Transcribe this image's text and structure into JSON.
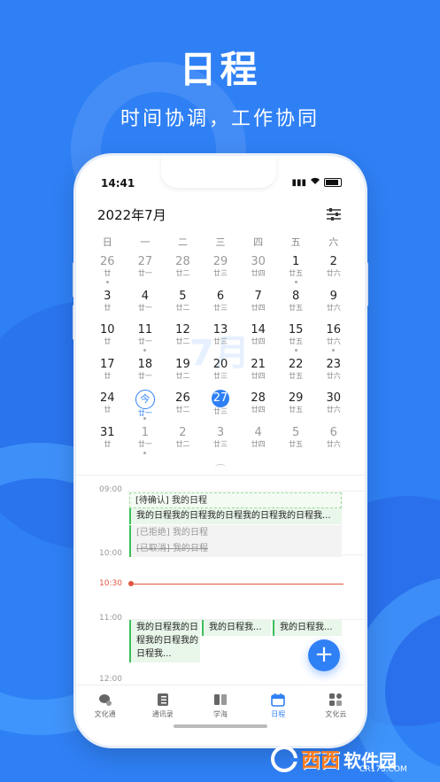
{
  "hero": {
    "title": "日程",
    "subtitle": "时间协调，工作协同"
  },
  "status": {
    "time": "14:41"
  },
  "calendar": {
    "month_title": "2022年7月",
    "watermark": "7月",
    "weekdays": [
      "日",
      "一",
      "二",
      "三",
      "四",
      "五",
      "六"
    ],
    "weeks": [
      [
        {
          "n": "26",
          "l": "廿",
          "o": true,
          "d": true
        },
        {
          "n": "27",
          "l": "廿一",
          "o": true
        },
        {
          "n": "28",
          "l": "廿二",
          "o": true
        },
        {
          "n": "29",
          "l": "廿三",
          "o": true
        },
        {
          "n": "30",
          "l": "廿四",
          "o": true
        },
        {
          "n": "1",
          "l": "廿五",
          "d": true
        },
        {
          "n": "2",
          "l": "廿六"
        }
      ],
      [
        {
          "n": "3",
          "l": "廿"
        },
        {
          "n": "4",
          "l": "廿一"
        },
        {
          "n": "5",
          "l": "廿二"
        },
        {
          "n": "6",
          "l": "廿三"
        },
        {
          "n": "7",
          "l": "廿四"
        },
        {
          "n": "8",
          "l": "廿五"
        },
        {
          "n": "9",
          "l": "廿六"
        }
      ],
      [
        {
          "n": "10",
          "l": "廿"
        },
        {
          "n": "11",
          "l": "廿一",
          "d": true
        },
        {
          "n": "12",
          "l": "廿二"
        },
        {
          "n": "13",
          "l": "廿三"
        },
        {
          "n": "14",
          "l": "廿四"
        },
        {
          "n": "15",
          "l": "廿五",
          "d": true
        },
        {
          "n": "16",
          "l": "廿六",
          "d": true
        }
      ],
      [
        {
          "n": "17",
          "l": "廿"
        },
        {
          "n": "18",
          "l": "廿一"
        },
        {
          "n": "19",
          "l": "廿二"
        },
        {
          "n": "20",
          "l": "廿三"
        },
        {
          "n": "21",
          "l": "廿四"
        },
        {
          "n": "22",
          "l": "廿五"
        },
        {
          "n": "23",
          "l": "廿六"
        }
      ],
      [
        {
          "n": "24",
          "l": "廿"
        },
        {
          "n": "今",
          "l": "廿一",
          "t": true,
          "d": true
        },
        {
          "n": "26",
          "l": "廿二"
        },
        {
          "n": "27",
          "l": "廿三",
          "s": true
        },
        {
          "n": "28",
          "l": "廿四"
        },
        {
          "n": "29",
          "l": "廿五"
        },
        {
          "n": "30",
          "l": "廿六"
        }
      ],
      [
        {
          "n": "31",
          "l": "廿"
        },
        {
          "n": "1",
          "l": "廿一",
          "o": true,
          "d": true
        },
        {
          "n": "2",
          "l": "廿二",
          "o": true
        },
        {
          "n": "3",
          "l": "廿三",
          "o": true
        },
        {
          "n": "4",
          "l": "廿四",
          "o": true
        },
        {
          "n": "5",
          "l": "廿五",
          "o": true
        },
        {
          "n": "6",
          "l": "廿六",
          "o": true
        }
      ]
    ]
  },
  "timeline": {
    "t0900": "09:00",
    "t1000": "10:00",
    "now": "10:30",
    "t1100": "11:00",
    "t1200": "12:00",
    "events": {
      "pending": "[待确认] 我的日程",
      "main": "我的日程我的日程我的日程我的日程我的日程我...",
      "rejected": "[已拒绝] 我的日程",
      "cancelled": "[已取消] 我的日程",
      "a": "我的日程我的日程我的日程我的日程我...",
      "b": "我的日程我...",
      "c": "我的日程我..."
    }
  },
  "fab_label": "+",
  "tabs": [
    {
      "label": "文化通",
      "icon": "chat-icon"
    },
    {
      "label": "通讯录",
      "icon": "contacts-icon"
    },
    {
      "label": "学海",
      "icon": "book-icon"
    },
    {
      "label": "日程",
      "icon": "calendar-icon",
      "active": true
    },
    {
      "label": "文化云",
      "icon": "apps-icon"
    }
  ],
  "site_logo": {
    "brand": "西西",
    "text": "软件园",
    "url": "CR173.COM"
  },
  "colors": {
    "accent": "#2f80f5",
    "now": "#e15541",
    "event_bar": "#3cbf5a"
  }
}
